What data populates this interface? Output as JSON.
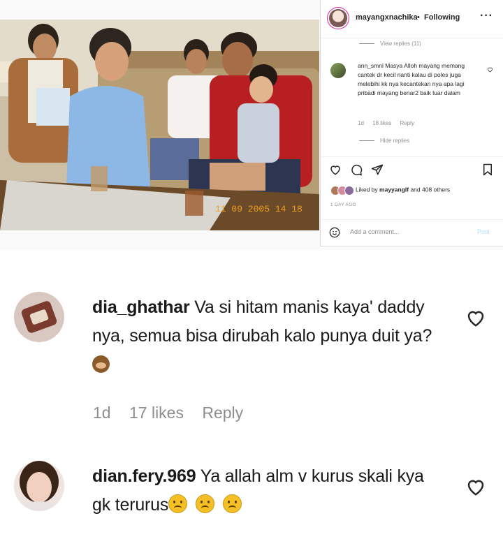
{
  "post": {
    "username": "mayangxnachika",
    "follow_state": "Following",
    "more_label": "···",
    "photo_timestamp": "11 09 2005 14 18",
    "view_replies": "View replies (11)",
    "comment": {
      "username": "ann_smnl",
      "text": "Masya Alloh mayang memang cantek dr kecil nanti kalau di poles juga melebihi kk nya kecantekan nya apa lagi pribadi mayang benar2 baik luar dalam",
      "age": "1d",
      "likes": "18 likes",
      "reply": "Reply"
    },
    "hide_replies": "Hide replies",
    "liked_by_prefix": "Liked by ",
    "liked_by_user": "mayyanglf",
    "liked_by_suffix": " and 408 others",
    "date": "1 DAY AGO",
    "add_comment_placeholder": "Add a comment...",
    "post_button": "Post"
  },
  "comments": [
    {
      "username": "dia_ghathar",
      "text": "Va si hitam manis kaya' daddy nya, semua bisa dirubah kalo punya duit ya?",
      "age": "1d",
      "likes": "17 likes",
      "reply": "Reply"
    },
    {
      "username": "dian.fery.969",
      "text": "Ya allah alm v kurus skali kya gk terurus"
    }
  ],
  "colors": {
    "text": "#262626",
    "muted": "#8e8e8e",
    "post_disabled": "#b2dffc",
    "story_ring": "#d6249f"
  }
}
